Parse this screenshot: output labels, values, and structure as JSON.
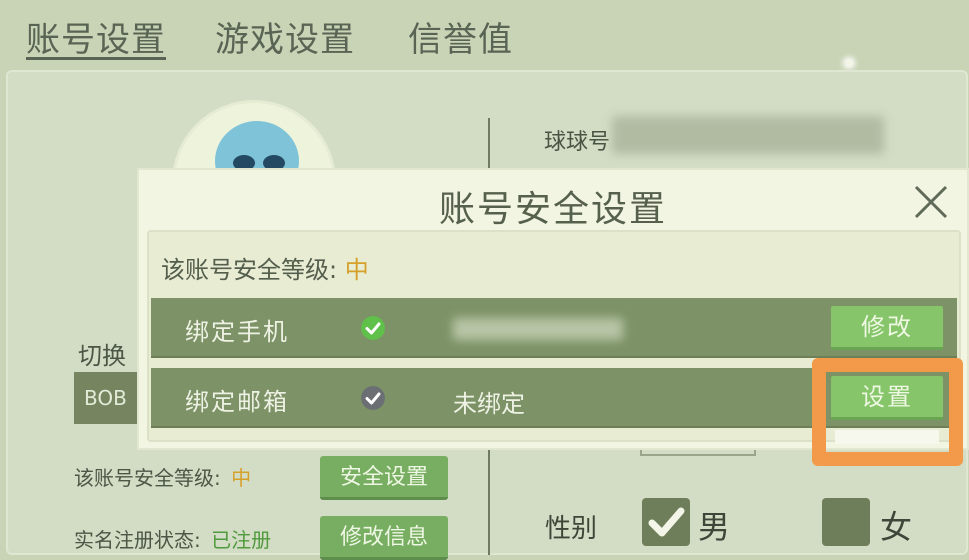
{
  "tabs": [
    {
      "label": "账号设置",
      "active": true
    },
    {
      "label": "游戏设置",
      "active": false
    },
    {
      "label": "信誉值",
      "active": false
    }
  ],
  "profile": {
    "switch_label": "切换",
    "account_box": "BOB",
    "security_level_label": "该账号安全等级:",
    "security_level_value": "中",
    "security_button": "安全设置",
    "realname_label": "实名注册状态:",
    "realname_value": "已注册",
    "edit_info_button": "修改信息"
  },
  "right": {
    "qq_label": "球球号",
    "gender_label": "性别",
    "gender_male": "男",
    "gender_female": "女"
  },
  "modal": {
    "title": "账号安全设置",
    "level_label": "该账号安全等级:",
    "level_value": "中",
    "rows": [
      {
        "label": "绑定手机",
        "status": "bound",
        "detail": "",
        "button": "修改"
      },
      {
        "label": "绑定邮箱",
        "status": "unbound",
        "detail": "未绑定",
        "button": "设置"
      }
    ]
  },
  "colors": {
    "accent_green": "#86c56a",
    "highlight": "#f29a4a",
    "level_medium": "#d6a12b"
  }
}
